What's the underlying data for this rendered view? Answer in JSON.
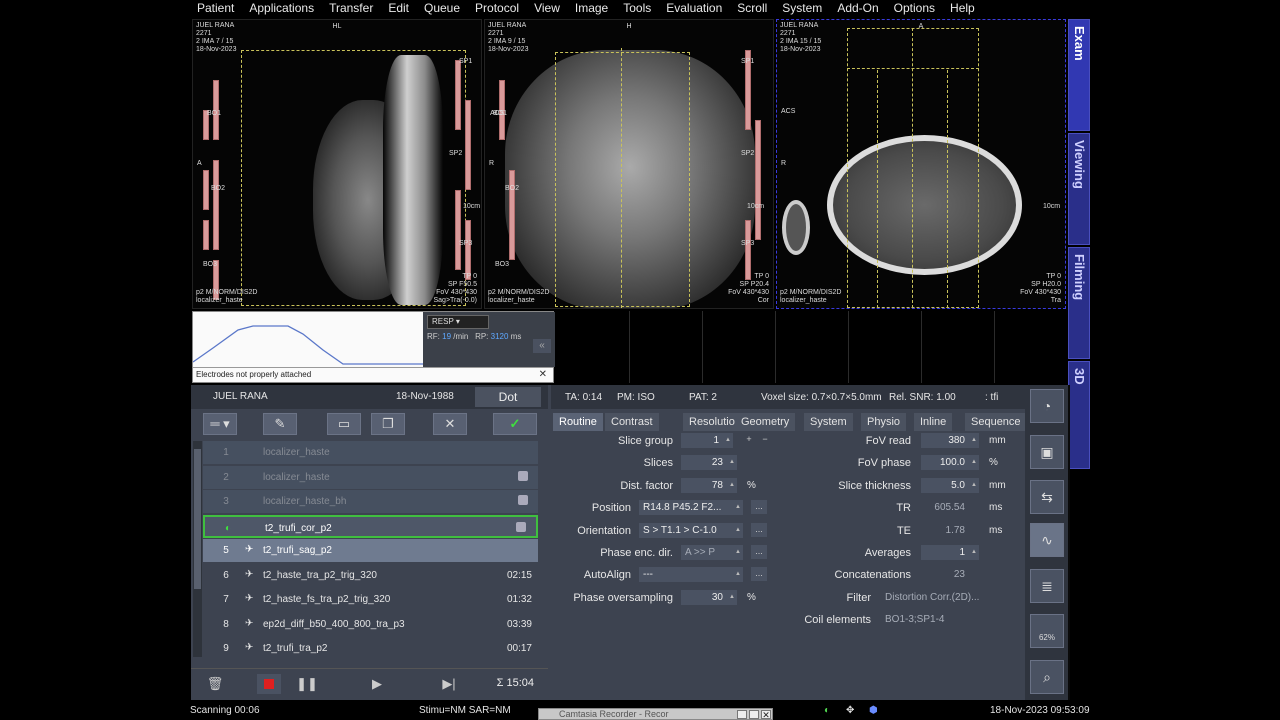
{
  "menu": [
    "Patient",
    "Applications",
    "Transfer",
    "Edit",
    "Queue",
    "Protocol",
    "View",
    "Image",
    "Tools",
    "Evaluation",
    "Scroll",
    "System",
    "Add-On",
    "Options",
    "Help"
  ],
  "viewports": [
    {
      "name": "JUEL RANA",
      "id": "2271",
      "ima": "2 IMA 7 / 15",
      "date": "18-Nov-2023",
      "orient_top": "HL",
      "bottom_left": "p2 M/NORM/DIS2D\nlocalizer_haste",
      "bottom_right": "TP 0\nSP F50.5\nFoV 430*430\nSag>Tra(-0.0)",
      "coils": [
        "BO1",
        "BO2",
        "BO3"
      ],
      "spine": [
        "SP1",
        "SP2",
        "SP3"
      ],
      "scale": "10cm",
      "side_a": "A",
      "side_r": "ACS"
    },
    {
      "name": "JUEL RANA",
      "id": "2271",
      "ima": "2 IMA 9 / 15",
      "date": "18-Nov-2023",
      "orient_top": "H",
      "bottom_left": "p2 M/NORM/DIS2D\nlocalizer_haste",
      "bottom_right": "TP 0\nSP P20.4\nFoV 430*430\nCor",
      "coils": [
        "BO1",
        "BO2",
        "BO3"
      ],
      "spine": [
        "SP1",
        "SP2",
        "SP3"
      ],
      "scale": "10cm",
      "side_a": "R",
      "side_r": "ACS"
    },
    {
      "name": "JUEL RANA",
      "id": "2271",
      "ima": "2 IMA 15 / 15",
      "date": "18-Nov-2023",
      "orient_top": "A",
      "bottom_left": "p2 M/NORM/DIS2D\nlocalizer_haste",
      "bottom_right": "TP 0\nSP H20.0\nFoV 430*430\nTra",
      "coils": [],
      "spine": [],
      "scale": "10cm",
      "side_a": "R",
      "side_r": "ACS"
    }
  ],
  "physio": {
    "mode": "RESP",
    "rf_label": "RF:",
    "rf_value": "19",
    "rf_unit": "/min",
    "rp_label": "RP:",
    "rp_value": "3120",
    "rp_unit": "ms",
    "warning": "Electrodes not properly attached",
    "close": "✕",
    "collapse": "«"
  },
  "patient": {
    "name": "JUEL RANA",
    "dob": "18-Nov-1988",
    "dot_label": "Dot"
  },
  "protocol_info": {
    "ta": "TA: 0:14",
    "pm": "PM: ISO",
    "pat": "PAT: 2",
    "voxel": "Voxel size: 0.7×0.7×5.0mm",
    "snr": "Rel. SNR: 1.00",
    "seq": ": tfi"
  },
  "queue": [
    {
      "num": "1",
      "name": "localizer_haste",
      "time": "",
      "state": "done"
    },
    {
      "num": "2",
      "name": "localizer_haste",
      "time": "",
      "state": "done"
    },
    {
      "num": "3",
      "name": "localizer_haste_bh",
      "time": "",
      "state": "done"
    },
    {
      "num": "",
      "name": "t2_trufi_cor_p2",
      "time": "",
      "state": "active"
    },
    {
      "num": "5",
      "name": "t2_trufi_sag_p2",
      "time": "",
      "state": "sel"
    },
    {
      "num": "6",
      "name": "t2_haste_tra_p2_trig_320",
      "time": "02:15",
      "state": "pend"
    },
    {
      "num": "7",
      "name": "t2_haste_fs_tra_p2_trig_320",
      "time": "01:32",
      "state": "pend"
    },
    {
      "num": "8",
      "name": "ep2d_diff_b50_400_800_tra_p3",
      "time": "03:39",
      "state": "pend"
    },
    {
      "num": "9",
      "name": "t2_trufi_tra_p2",
      "time": "00:17",
      "state": "pend"
    }
  ],
  "total_time": "Σ 15:04",
  "tabs": [
    "Routine",
    "Contrast",
    "Resolution",
    "Geometry",
    "System",
    "Physio",
    "Inline",
    "Sequence"
  ],
  "params_left": [
    {
      "label": "Slice group",
      "value": "1",
      "unit": ""
    },
    {
      "label": "Slices",
      "value": "23",
      "unit": ""
    },
    {
      "label": "Dist. factor",
      "value": "78",
      "unit": "%"
    },
    {
      "label": "Position",
      "value": "R14.8 P45.2 F2...",
      "unit": ""
    },
    {
      "label": "Orientation",
      "value": "S > T1.1 > C-1.0",
      "unit": ""
    },
    {
      "label": "Phase enc. dir.",
      "value": "A >> P",
      "unit": ""
    },
    {
      "label": "AutoAlign",
      "value": "---",
      "unit": ""
    },
    {
      "label": "Phase oversampling",
      "value": "30",
      "unit": "%"
    }
  ],
  "params_right": [
    {
      "label": "FoV read",
      "value": "380",
      "unit": "mm"
    },
    {
      "label": "FoV phase",
      "value": "100.0",
      "unit": "%"
    },
    {
      "label": "Slice thickness",
      "value": "5.0",
      "unit": "mm"
    },
    {
      "label": "TR",
      "value": "605.54",
      "unit": "ms"
    },
    {
      "label": "TE",
      "value": "1.78",
      "unit": "ms"
    },
    {
      "label": "Averages",
      "value": "1",
      "unit": ""
    },
    {
      "label": "Concatenations",
      "value": "23",
      "unit": ""
    },
    {
      "label": "Filter",
      "value": "Distortion Corr.(2D)...",
      "unit": ""
    },
    {
      "label": "Coil elements",
      "value": "BO1-3;SP1-4",
      "unit": ""
    }
  ],
  "side_tabs": [
    "Exam",
    "Viewing",
    "Filming",
    "3D"
  ],
  "right_tool_badge": "62%",
  "status": {
    "scanning": "Scanning 00:06",
    "stimu": "Stimu=NM SAR=NM",
    "datetime": "18-Nov-2023 09:53:09",
    "recorder": "Camtasia Recorder - Recor"
  }
}
